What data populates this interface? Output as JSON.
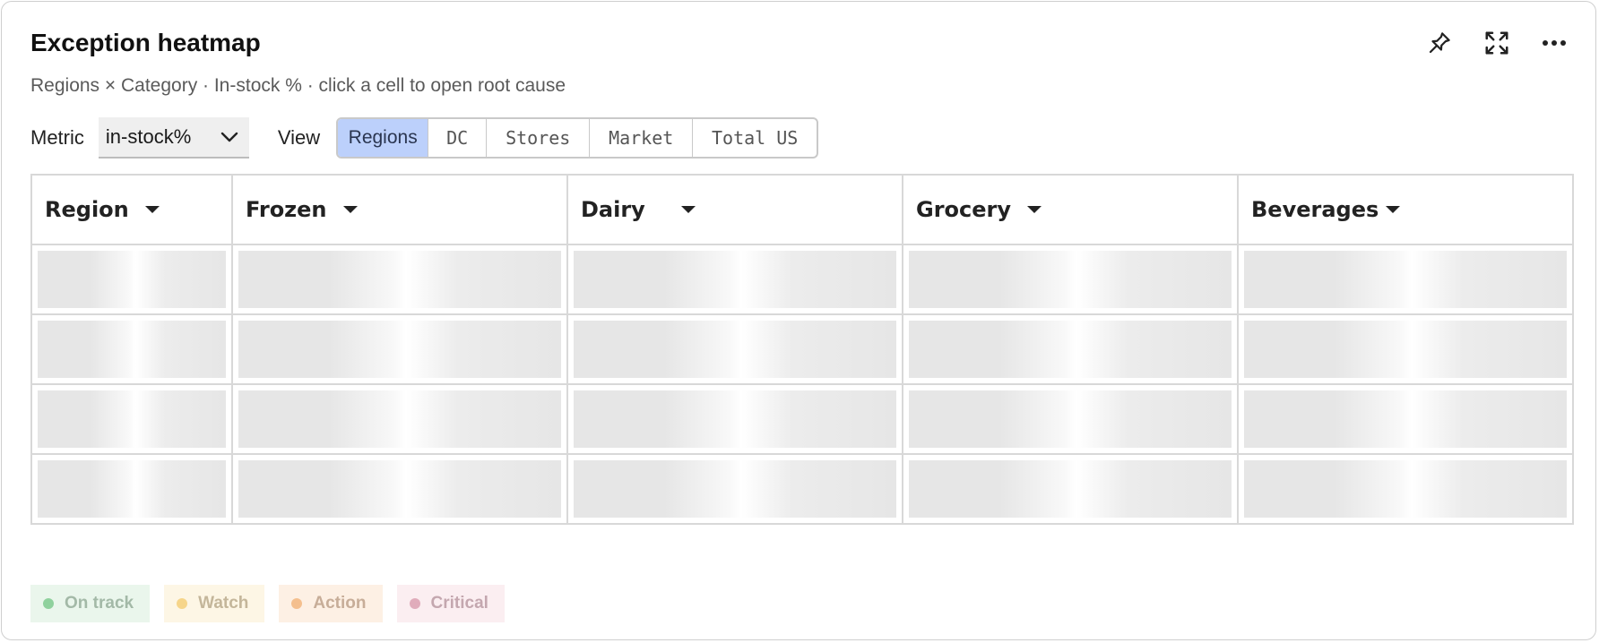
{
  "card": {
    "title": "Exception heatmap",
    "subtitle": "Regions × Category · In-stock % · click a cell to open root cause",
    "actions": [
      "pin-icon",
      "expand-icon",
      "more-icon"
    ]
  },
  "controls": {
    "metric_label": "Metric",
    "metric_value": "in-stock%",
    "view_label": "View",
    "views": [
      "Regions",
      "DC",
      "Stores",
      "Market",
      "Total US"
    ],
    "active_view": "Regions"
  },
  "table": {
    "columns": [
      "Region",
      "Frozen",
      "Dairy",
      "Grocery",
      "Beverages"
    ],
    "row_count_loading": 4
  },
  "legend": [
    {
      "label": "On track",
      "color": "#5fbf76",
      "bg": "#eaf6ec",
      "text": "#a3b9a7"
    },
    {
      "label": "Watch",
      "color": "#f2c35a",
      "bg": "#fdf6e5",
      "text": "#c4b69a"
    },
    {
      "label": "Action",
      "color": "#f0a15a",
      "bg": "#fdf0e4",
      "text": "#c7ad98"
    },
    {
      "label": "Critical",
      "color": "#d98aa0",
      "bg": "#fbeef1",
      "text": "#c4a7af"
    }
  ]
}
